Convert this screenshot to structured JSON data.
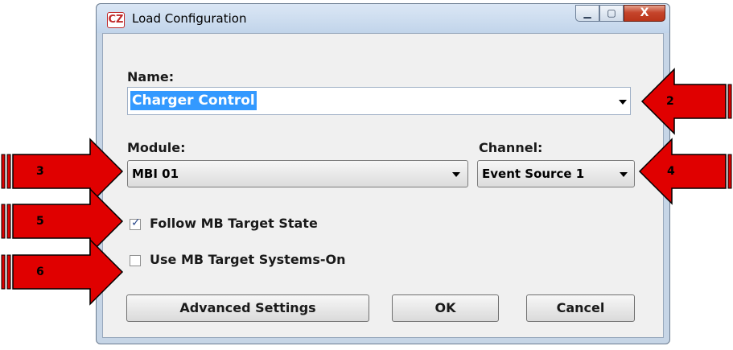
{
  "window": {
    "title": "Load Configuration",
    "icon_text": "CZ",
    "minimize_label": "—",
    "maximize_label": "▢",
    "close_label": "X"
  },
  "form": {
    "name_label": "Name:",
    "name_value": "Charger Control",
    "module_label": "Module:",
    "module_value": "MBI 01",
    "channel_label": "Channel:",
    "channel_value": "Event Source 1",
    "follow_state_label": "Follow MB Target State",
    "follow_state_checked": true,
    "systems_on_label": "Use MB Target Systems-On",
    "systems_on_checked": false
  },
  "buttons": {
    "advanced": "Advanced Settings",
    "ok": "OK",
    "cancel": "Cancel"
  },
  "annotations": [
    "2",
    "3",
    "4",
    "5",
    "6"
  ],
  "colors": {
    "annotation_red": "#e00000",
    "selection_blue": "#3399ff",
    "close_red": "#c5452c"
  }
}
